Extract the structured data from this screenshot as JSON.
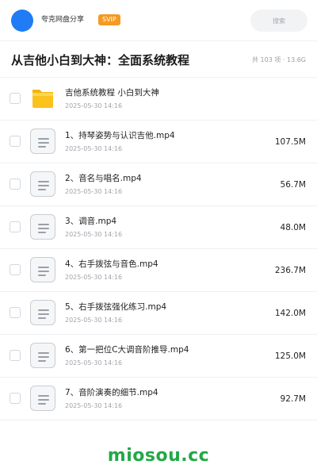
{
  "header": {
    "username": "夸克网盘分享",
    "badge": "SVIP",
    "search_placeholder": "搜索"
  },
  "folder_title": "从吉他小白到大神：全面系统教程",
  "meta": "共 103 项 · 13.6G",
  "items": [
    {
      "type": "folder",
      "name": "吉他系统教程 小白到大神",
      "date": "2025-05-30 14:16",
      "size": ""
    },
    {
      "type": "file",
      "name": "1、持琴姿势与认识吉他.mp4",
      "date": "2025-05-30 14:16",
      "size": "107.5M"
    },
    {
      "type": "file",
      "name": "2、音名与唱名.mp4",
      "date": "2025-05-30 14:16",
      "size": "56.7M"
    },
    {
      "type": "file",
      "name": "3、调音.mp4",
      "date": "2025-05-30 14:16",
      "size": "48.0M"
    },
    {
      "type": "file",
      "name": "4、右手拨弦与音色.mp4",
      "date": "2025-05-30 14:16",
      "size": "236.7M"
    },
    {
      "type": "file",
      "name": "5、右手拨弦强化练习.mp4",
      "date": "2025-05-30 14:16",
      "size": "142.0M"
    },
    {
      "type": "file",
      "name": "6、第一把位C大调音阶推导.mp4",
      "date": "2025-05-30 14:16",
      "size": "125.0M"
    },
    {
      "type": "file",
      "name": "7、音阶演奏的细节.mp4",
      "date": "2025-05-30 14:16",
      "size": "92.7M"
    }
  ],
  "watermark": "miosou.cc",
  "colors": {
    "avatar": "#1f7cf5",
    "svip_badge": "#f59a23",
    "folder_icon": "#fbc21b",
    "watermark": "#22a846"
  }
}
